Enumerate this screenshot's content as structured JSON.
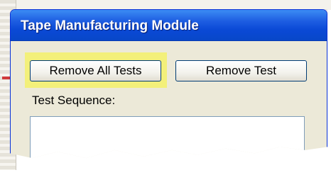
{
  "window": {
    "title": "Tape Manufacturing Module"
  },
  "toolbar": {
    "remove_all_tests_label": "Remove All Tests",
    "remove_test_label": "Remove Test"
  },
  "test_sequence": {
    "label": "Test Sequence:",
    "items": []
  },
  "colors": {
    "titlebar": "#0a49d6",
    "window_face": "#ece9d8",
    "highlight": "#f3f07a"
  }
}
